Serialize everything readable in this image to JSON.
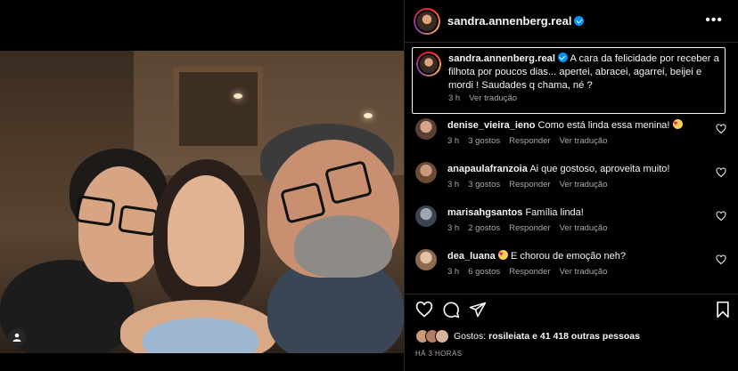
{
  "post": {
    "username": "sandra.annenberg.real",
    "more_icon": "more-horizontal-icon",
    "caption": {
      "username": "sandra.annenberg.real",
      "text": "A cara da felicidade por receber a filhota por poucos dias... apertei, abracei, agarrei, beijei e mordi ! Saudades q chama, né ?",
      "time": "3 h",
      "translate": "Ver tradução"
    }
  },
  "comments": [
    {
      "username": "denise_vieira_ieno",
      "text": "Como está linda essa menina!",
      "emoji": "heart-eyes",
      "time": "3 h",
      "likes": "3 gostos",
      "reply": "Responder",
      "translate": "Ver tradução",
      "avatar_color": "#d4a58a"
    },
    {
      "username": "anapaulafranzoia",
      "text": "Ai que gostoso, aproveita muito!",
      "emoji": "",
      "time": "3 h",
      "likes": "3 gostos",
      "reply": "Responder",
      "translate": "Ver tradução",
      "avatar_color": "#c99a7b"
    },
    {
      "username": "marisahgsantos",
      "text": "Família linda!",
      "emoji": "",
      "time": "3 h",
      "likes": "2 gostos",
      "reply": "Responder",
      "translate": "Ver tradução",
      "avatar_color": "#9ea6b2"
    },
    {
      "username": "dea_luana",
      "text": "E chorou de emoção neh?",
      "emoji": "heart-eyes",
      "time": "3 h",
      "likes": "6 gostos",
      "reply": "Responder",
      "translate": "Ver tradução",
      "avatar_color": "#e2c3a8"
    }
  ],
  "likes": {
    "prefix": "Gostos: ",
    "user": "rosileiata",
    "suffix": " e 41 418 outras pessoas"
  },
  "time_ago": "HÁ 3 HORAS",
  "icons": {
    "like": "heart-icon",
    "comment": "comment-icon",
    "share": "send-icon",
    "save": "bookmark-icon",
    "tag": "user-tag-icon"
  },
  "colors": {
    "background": "#000000",
    "text": "#f5f5f5",
    "secondary": "#a8a8a8",
    "verified": "#0095f6",
    "border": "#262626"
  }
}
